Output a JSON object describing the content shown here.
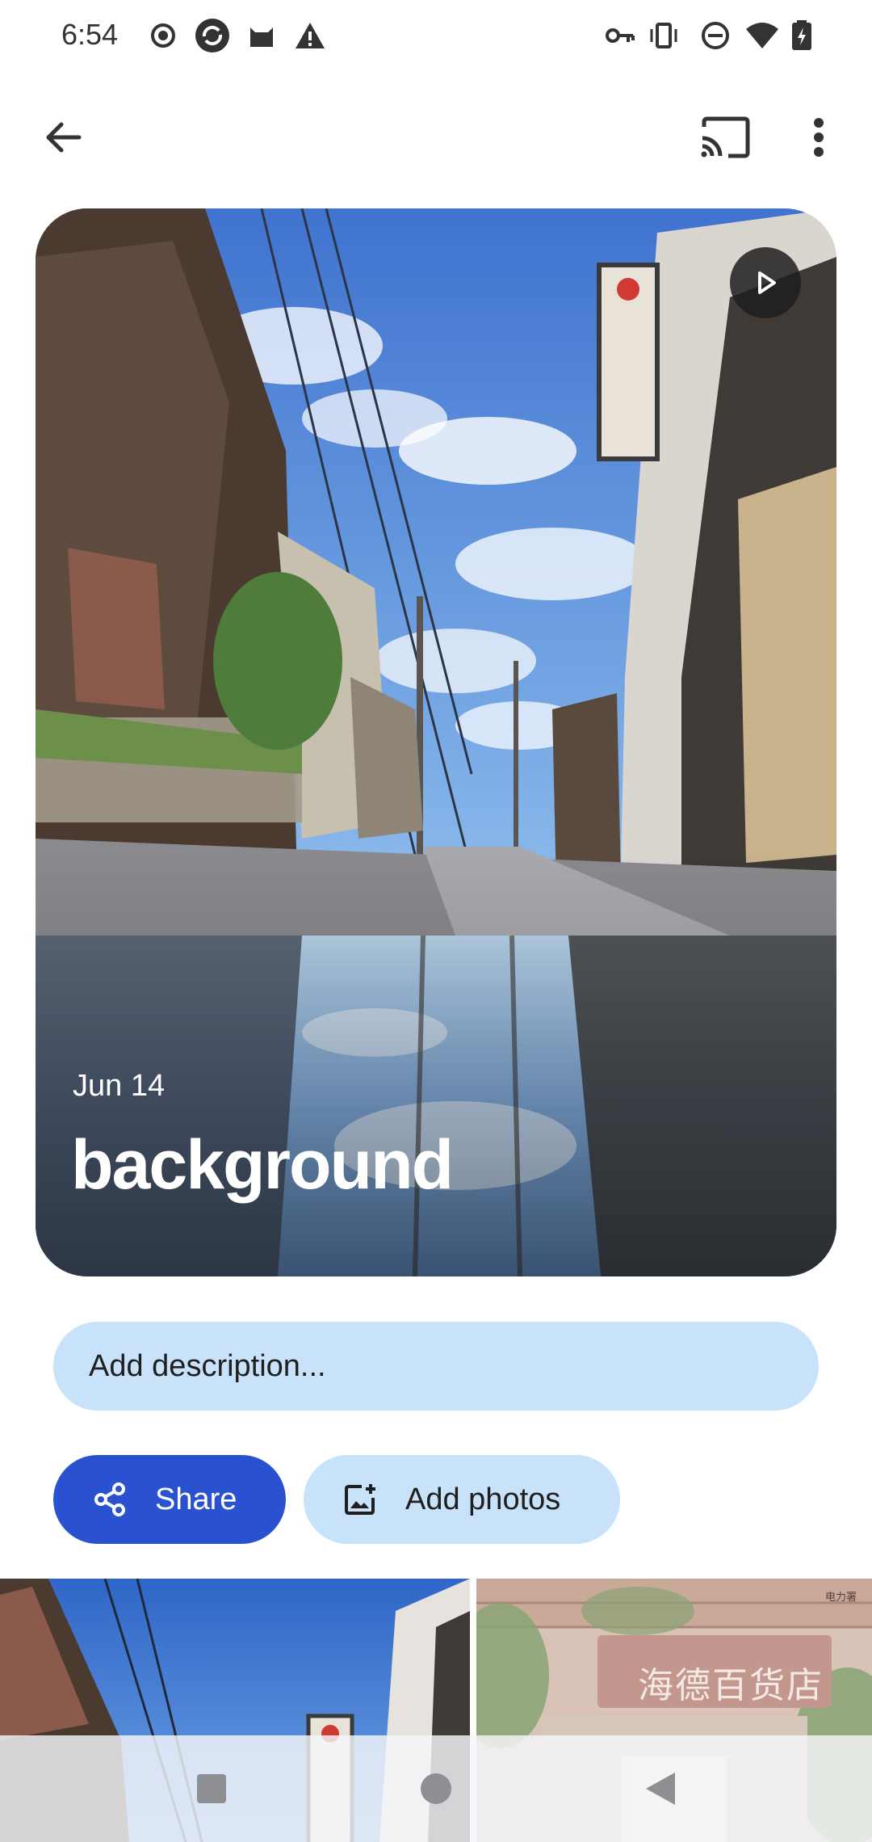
{
  "status_bar": {
    "time": "6:54",
    "left_icons": [
      "record-icon",
      "sync-icon",
      "cat-icon",
      "warning-icon"
    ],
    "right_icons": [
      "vpn-key-icon",
      "vibrate-icon",
      "do-not-disturb-icon",
      "wifi-icon",
      "battery-charging-icon"
    ]
  },
  "app_bar": {
    "back_icon": "arrow-back-icon",
    "cast_icon": "cast-icon",
    "more_icon": "more-vert-icon"
  },
  "album": {
    "date": "Jun 14",
    "title": "background",
    "slideshow_icon": "play-icon"
  },
  "description": {
    "placeholder": "Add description..."
  },
  "actions": {
    "share_label": "Share",
    "add_photos_label": "Add photos"
  },
  "thumbnails": [
    {
      "name": "street-photo"
    },
    {
      "name": "shop-photo",
      "sign_text": "海德百货店",
      "small_text": "电力署"
    }
  ],
  "colors": {
    "primary": "#2a52d0",
    "tonal": "#c7e2f9",
    "background": "#ffffff"
  },
  "nav_bar": {
    "recents_icon": "square-icon",
    "home_icon": "circle-icon",
    "back_icon": "triangle-back-icon"
  }
}
